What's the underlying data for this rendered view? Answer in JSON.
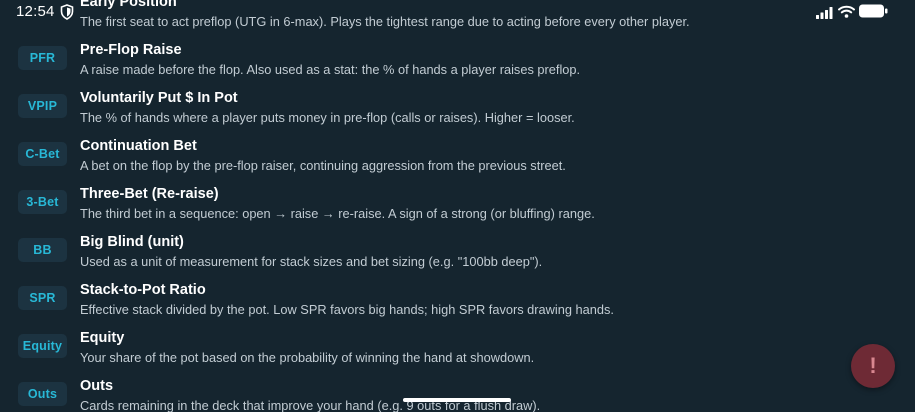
{
  "status_bar": {
    "time": "12:54"
  },
  "glossary": [
    {
      "badge": "",
      "term": "Early Position",
      "desc": "The first seat to act preflop (UTG in 6-max). Plays the tightest range due to acting before every other player."
    },
    {
      "badge": "PFR",
      "term": "Pre-Flop Raise",
      "desc": "A raise made before the flop. Also used as a stat: the % of hands a player raises preflop."
    },
    {
      "badge": "VPIP",
      "term": "Voluntarily Put $ In Pot",
      "desc": "The % of hands where a player puts money in pre-flop (calls or raises). Higher = looser."
    },
    {
      "badge": "C-Bet",
      "term": "Continuation Bet",
      "desc": "A bet on the flop by the pre-flop raiser, continuing aggression from the previous street."
    },
    {
      "badge": "3-Bet",
      "term": "Three-Bet (Re-raise)",
      "desc": "The third bet in a sequence: open → raise → re-raise. A sign of a strong (or bluffing) range."
    },
    {
      "badge": "BB",
      "term": "Big Blind (unit)",
      "desc": "Used as a unit of measurement for stack sizes and bet sizing (e.g. \"100bb deep\")."
    },
    {
      "badge": "SPR",
      "term": "Stack-to-Pot Ratio",
      "desc": "Effective stack divided by the pot. Low SPR favors big hands; high SPR favors drawing hands."
    },
    {
      "badge": "Equity",
      "term": "Equity",
      "desc": "Your share of the pot based on the probability of winning the hand at showdown."
    },
    {
      "badge": "Outs",
      "term": "Outs",
      "desc": "Cards remaining in the deck that improve your hand (e.g. 9 outs for a flush draw)."
    }
  ],
  "fab": {
    "label": "!"
  },
  "colors": {
    "background": "#15252f",
    "badge_bg": "#1c3341",
    "badge_text": "#28b8d6",
    "fab_bg": "#6e2a35"
  },
  "icons": [
    "shield-icon",
    "signal-icon",
    "wifi-icon",
    "battery-icon"
  ]
}
